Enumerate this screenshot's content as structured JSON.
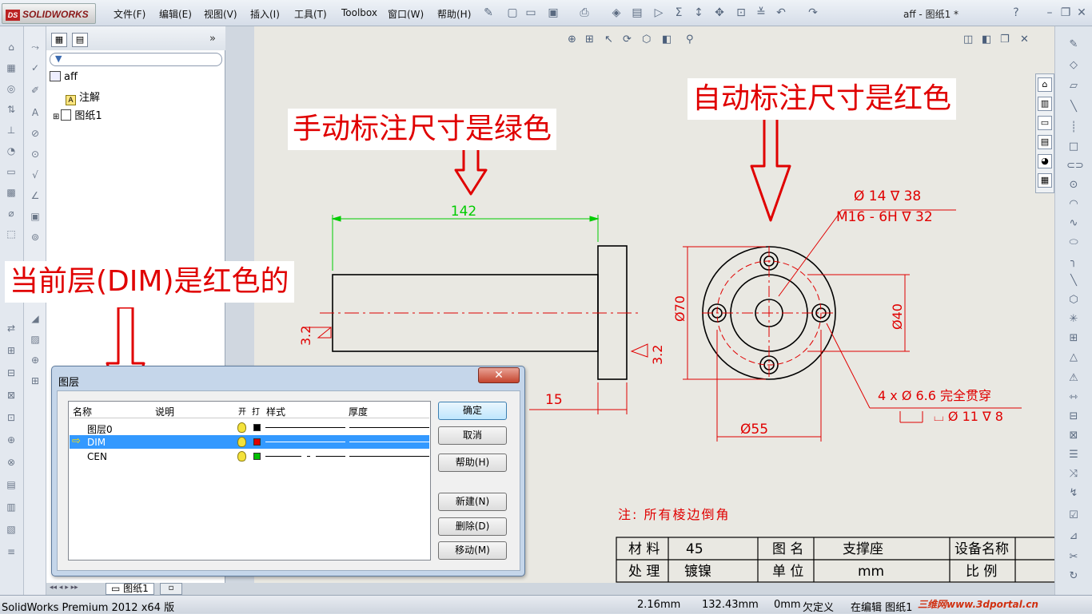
{
  "app": {
    "logo_text": "SOLIDWORKS",
    "logo_badge": "DS",
    "window_title": "aff - 图纸1 *",
    "menu": [
      "文件(F)",
      "编辑(E)",
      "视图(V)",
      "插入(I)",
      "工具(T)",
      "Toolbox",
      "窗口(W)",
      "帮助(H)"
    ]
  },
  "tree": {
    "root": "aff",
    "items": [
      "注解",
      "图纸1"
    ]
  },
  "annotations": {
    "manual": "手动标注尺寸是绿色",
    "auto": "自动标注尺寸是红色",
    "layer": "当前层(DIM)是红色的"
  },
  "drawing": {
    "dim_142": "142",
    "dim_15": "15",
    "dim_32_left": "3.2",
    "dim_32_right": "3.2",
    "dim_70": "Ø70",
    "dim_40": "Ø40",
    "dim_55": "Ø55",
    "hole_callout_1": "Ø 14 ∇ 38",
    "hole_callout_2": "M16 - 6H ∇ 32",
    "hole_callout_3": "4 x Ø 6.6 完全贯穿",
    "hole_callout_4": "⌴ Ø 11 ∇ 8",
    "note": "注: 所有棱边倒角"
  },
  "title_block": {
    "r1": [
      "材 料",
      "45",
      "图 名",
      "支撑座",
      "设备名称"
    ],
    "r2": [
      "处 理",
      "镀镍",
      "单 位",
      "mm",
      "比 例"
    ]
  },
  "dialog": {
    "title": "图层",
    "close": "✕",
    "headers": [
      "名称",
      "说明",
      "开",
      "打",
      "样式",
      "厚度"
    ],
    "layers": [
      {
        "name": "图层0",
        "color": "#000000",
        "selected": false,
        "current": false
      },
      {
        "name": "DIM",
        "color": "#e00000",
        "selected": true,
        "current": true
      },
      {
        "name": "CEN",
        "color": "#00c000",
        "selected": false,
        "current": false
      }
    ],
    "buttons": {
      "ok": "确定",
      "cancel": "取消",
      "help": "帮助(H)",
      "new": "新建(N)",
      "delete": "删除(D)",
      "move": "移动(M)"
    }
  },
  "sheet_tab": "图纸1",
  "status": {
    "product": "SolidWorks Premium 2012 x64 版",
    "x": "2.16mm",
    "y": "132.43mm",
    "z": "0mm",
    "defined": "欠定义",
    "editing": "在编辑 图纸1",
    "watermark": "三维网www.3dportal.cn"
  },
  "colors": {
    "annotation_text": "#e00000",
    "auto_dim": "#e00000",
    "manual_dim": "#00cc00",
    "selected_row": "#3399ff"
  }
}
